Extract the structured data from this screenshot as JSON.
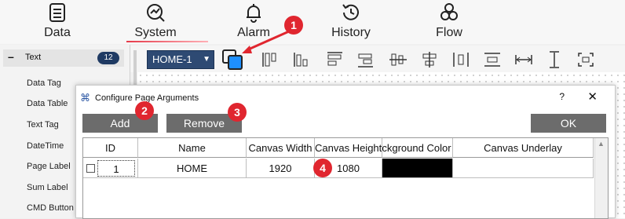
{
  "nav": {
    "tabs": [
      {
        "label": "Data",
        "icon": "data-icon"
      },
      {
        "label": "System",
        "icon": "system-icon",
        "active": true
      },
      {
        "label": "Alarm",
        "icon": "bell-icon"
      },
      {
        "label": "History",
        "icon": "history-icon"
      },
      {
        "label": "Flow",
        "icon": "flow-icon"
      }
    ]
  },
  "sidebar": {
    "group_label": "Text",
    "group_count": "12",
    "items": [
      "Data Tag",
      "Data Table",
      "Text Tag",
      "DateTime",
      "Page Label",
      "Sum Label",
      "CMD Button"
    ]
  },
  "toolbar": {
    "page_select_value": "HOME-1"
  },
  "dialog": {
    "title": "Configure Page Arguments",
    "help": "?",
    "close": "X",
    "add_label": "Add",
    "remove_label": "Remove",
    "ok_label": "OK",
    "table": {
      "columns": [
        "ID",
        "Name",
        "Canvas Width",
        "Canvas Height",
        "Background Color",
        "Canvas Underlay"
      ],
      "rows": [
        {
          "id": "1",
          "name": "HOME",
          "width": "1920",
          "height": "1080",
          "bg_color": "#000000",
          "underlay": ""
        }
      ]
    }
  },
  "callouts": [
    "1",
    "2",
    "3",
    "4"
  ],
  "colors": {
    "accent": "#e0262f",
    "dark_blue": "#2e4a73",
    "button_gray": "#6c6c6c"
  }
}
